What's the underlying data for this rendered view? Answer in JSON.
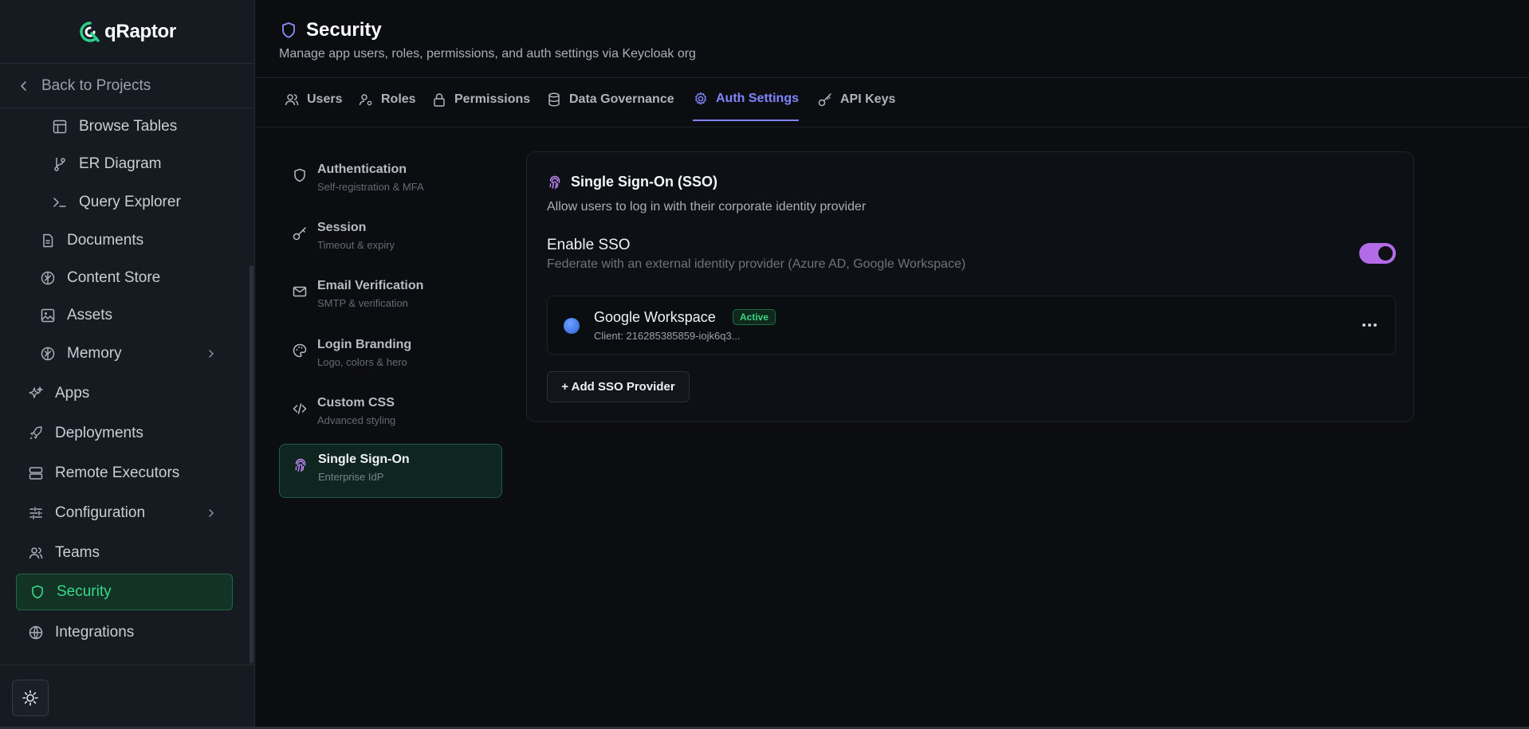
{
  "app": {
    "logo_text": "qRaptor"
  },
  "sidebar": {
    "back_label": "Back to Projects",
    "items": [
      {
        "label": "Browse Tables",
        "icon": "table-icon"
      },
      {
        "label": "ER Diagram",
        "icon": "git-branch-icon"
      },
      {
        "label": "Query Explorer",
        "icon": "terminal-icon"
      },
      {
        "label": "Documents",
        "icon": "document-icon"
      },
      {
        "label": "Content Store",
        "icon": "brain-icon"
      },
      {
        "label": "Assets",
        "icon": "image-icon"
      },
      {
        "label": "Memory",
        "icon": "brain-icon"
      },
      {
        "label": "Apps",
        "icon": "sparkles-icon"
      },
      {
        "label": "Deployments",
        "icon": "rocket-icon"
      },
      {
        "label": "Remote Executors",
        "icon": "server-icon"
      },
      {
        "label": "Configuration",
        "icon": "sliders-icon"
      },
      {
        "label": "Teams",
        "icon": "users-icon"
      },
      {
        "label": "Security",
        "icon": "shield-icon"
      },
      {
        "label": "Integrations",
        "icon": "globe-icon"
      }
    ],
    "active_item": "Security"
  },
  "header": {
    "title": "Security",
    "subtitle": "Manage app users, roles, permissions, and auth settings via Keycloak org"
  },
  "tabs": [
    {
      "label": "Users"
    },
    {
      "label": "Roles"
    },
    {
      "label": "Permissions"
    },
    {
      "label": "Data Governance"
    },
    {
      "label": "Auth Settings"
    },
    {
      "label": "API Keys"
    }
  ],
  "active_tab": "Auth Settings",
  "settings_nav": [
    {
      "title": "Authentication",
      "desc": "Self-registration & MFA"
    },
    {
      "title": "Session",
      "desc": "Timeout & expiry"
    },
    {
      "title": "Email Verification",
      "desc": "SMTP & verification"
    },
    {
      "title": "Login Branding",
      "desc": "Logo, colors & hero"
    },
    {
      "title": "Custom CSS",
      "desc": "Advanced styling"
    },
    {
      "title": "Single Sign-On",
      "desc": "Enterprise IdP"
    }
  ],
  "sso": {
    "title": "Single Sign-On (SSO)",
    "subtitle": "Allow users to log in with their corporate identity provider",
    "enable_label": "Enable SSO",
    "enable_desc": "Federate with an external identity provider (Azure AD, Google Workspace)",
    "enabled": true,
    "provider": {
      "name": "Google Workspace",
      "status": "Active",
      "client": "Client: 216285385859-iojk6q3..."
    },
    "add_button": "+ Add SSO Provider"
  },
  "colors": {
    "accent_green": "#39d98a",
    "accent_indigo": "#7f84ff",
    "toggle_purple": "#b36be8"
  }
}
